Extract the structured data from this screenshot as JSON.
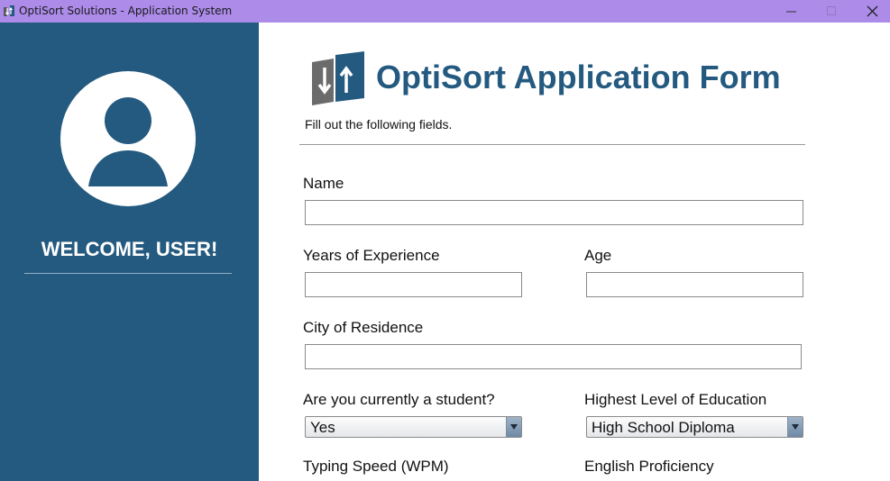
{
  "window": {
    "title": "OptiSort Solutions - Application System",
    "icon": "optisort-logo-icon"
  },
  "sidebar": {
    "welcome": "WELCOME, USER!",
    "avatar_icon": "user-avatar-icon"
  },
  "header": {
    "title": "OptiSort Application Form",
    "subtitle": "Fill out the following fields."
  },
  "form": {
    "name_label": "Name",
    "name_value": "",
    "experience_label": "Years of Experience",
    "experience_value": "",
    "age_label": "Age",
    "age_value": "",
    "city_label": "City of Residence",
    "city_value": "",
    "student_label": "Are you currently a student?",
    "student_value": "Yes",
    "education_label": "Highest Level of Education",
    "education_value": "High School Diploma",
    "typing_label": "Typing Speed (WPM)",
    "english_label": "English Proficiency"
  },
  "colors": {
    "titlebar": "#ac8be9",
    "sidebar": "#245a80",
    "accent": "#245a80"
  }
}
